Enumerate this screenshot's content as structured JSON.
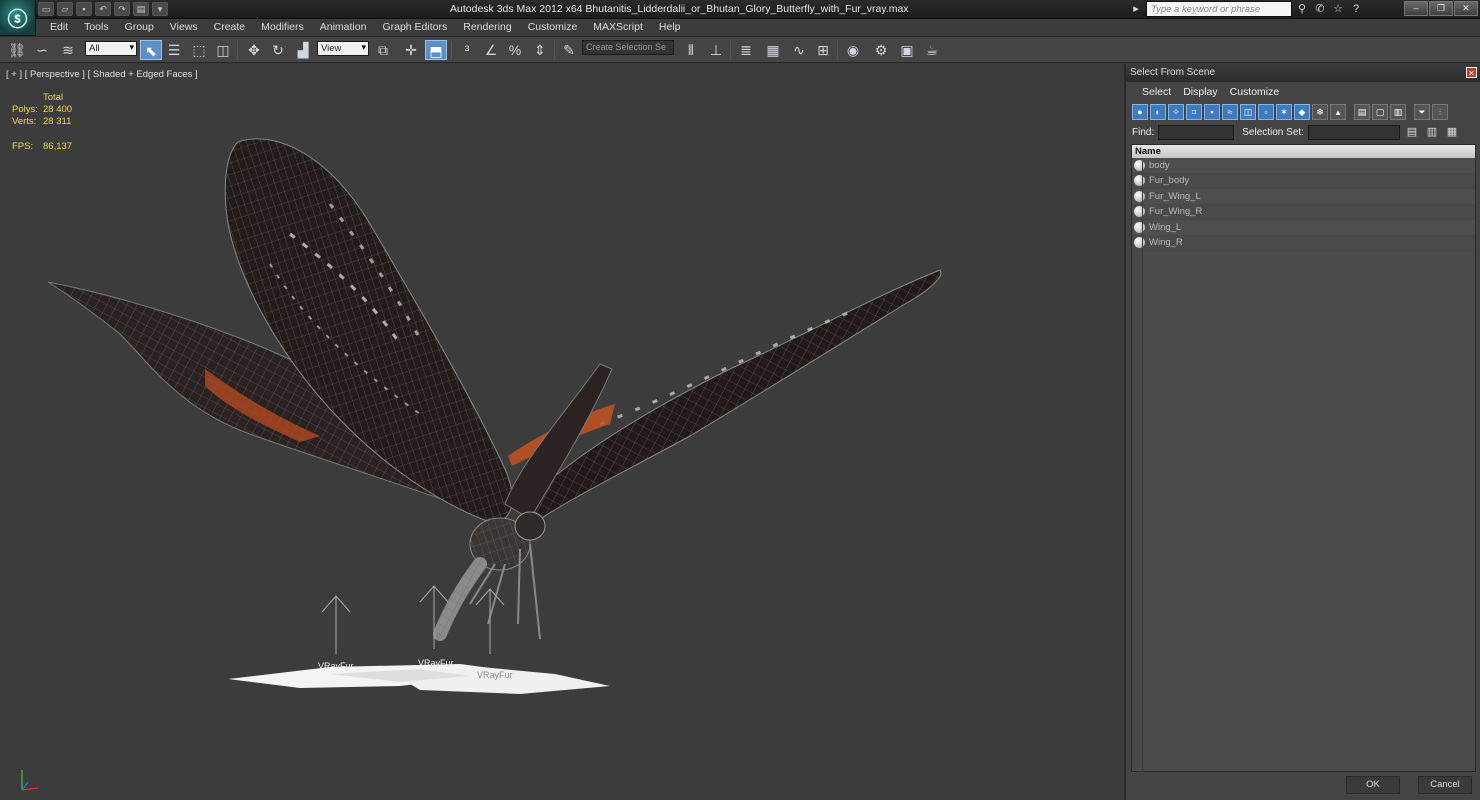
{
  "window": {
    "title": "Autodesk 3ds Max  2012 x64     Bhutanitis_Lidderdalii_or_Bhutan_Glory_Butterfly_with_Fur_vray.max",
    "search_placeholder": "Type a keyword or phrase"
  },
  "menu": [
    "Edit",
    "Tools",
    "Group",
    "Views",
    "Create",
    "Modifiers",
    "Animation",
    "Graph Editors",
    "Rendering",
    "Customize",
    "MAXScript",
    "Help"
  ],
  "toolbar": {
    "filter_value": "All",
    "coord_value": "View",
    "selection_set_placeholder": "Create Selection Se"
  },
  "viewport": {
    "label": "[ + ] [ Perspective ] [ Shaded + Edged Faces ]",
    "stats": {
      "total_label": "Total",
      "polys_label": "Polys:",
      "polys_value": "28 400",
      "verts_label": "Verts:",
      "verts_value": "28 311",
      "fps_label": "FPS:",
      "fps_value": "86,137"
    },
    "fur_labels": [
      "VRayFur",
      "VRayFur",
      "VRayFur"
    ]
  },
  "scene_panel": {
    "title": "Select From Scene",
    "menu": [
      "Select",
      "Display",
      "Customize"
    ],
    "find_label": "Find:",
    "selection_set_label": "Selection Set:",
    "column_header": "Name",
    "items": [
      "body",
      "Fur_body",
      "Fur_Wing_L",
      "Fur_Wing_R",
      "Wing_L",
      "Wing_R"
    ],
    "ok_label": "OK",
    "cancel_label": "Cancel"
  },
  "colors": {
    "viewport_bg": "#3c3c3c",
    "stats_text": "#f2d94a",
    "active_tool": "#5e8fc9"
  }
}
